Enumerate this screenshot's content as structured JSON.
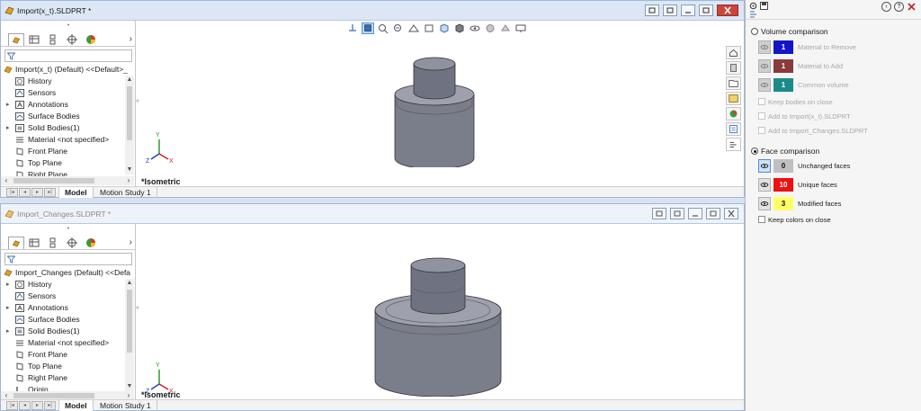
{
  "windows": [
    {
      "title": "Import(x_t).SLDPRT *",
      "root": "Import(x_t) (Default) <<Default>_",
      "tree": [
        {
          "label": "History",
          "arrow": ""
        },
        {
          "label": "Sensors",
          "arrow": ""
        },
        {
          "label": "Annotations",
          "arrow": "▸"
        },
        {
          "label": "Surface Bodies",
          "arrow": ""
        },
        {
          "label": "Solid Bodies(1)",
          "arrow": "▸"
        },
        {
          "label": "Material <not specified>",
          "arrow": ""
        },
        {
          "label": "Front Plane",
          "arrow": ""
        },
        {
          "label": "Top Plane",
          "arrow": ""
        },
        {
          "label": "Right Plane",
          "arrow": ""
        }
      ],
      "view_label": "*Isometric"
    },
    {
      "title": "Import_Changes.SLDPRT *",
      "root": "Import_Changes (Default) <<Defa",
      "tree": [
        {
          "label": "History",
          "arrow": "▸"
        },
        {
          "label": "Sensors",
          "arrow": ""
        },
        {
          "label": "Annotations",
          "arrow": "▸"
        },
        {
          "label": "Surface Bodies",
          "arrow": ""
        },
        {
          "label": "Solid Bodies(1)",
          "arrow": "▸"
        },
        {
          "label": "Material <not specified>",
          "arrow": ""
        },
        {
          "label": "Front Plane",
          "arrow": ""
        },
        {
          "label": "Top Plane",
          "arrow": ""
        },
        {
          "label": "Right Plane",
          "arrow": ""
        },
        {
          "label": "Origin",
          "arrow": ""
        }
      ],
      "view_label": "*Isometric"
    }
  ],
  "tabs": {
    "model": "Model",
    "motion": "Motion Study 1"
  },
  "triad": {
    "x": "X",
    "y": "Y",
    "z": "Z"
  },
  "property_manager": {
    "volume_comparison": {
      "label": "Volume comparison",
      "selected": false,
      "rows": [
        {
          "count": "1",
          "label": "Material to Remove",
          "color": "#1414c8"
        },
        {
          "count": "1",
          "label": "Material to Add",
          "color": "#8a3a3a"
        },
        {
          "count": "1",
          "label": "Common volume",
          "color": "#1a8a8a"
        }
      ],
      "checks": [
        {
          "label": "Keep bodies on close",
          "enabled": false
        },
        {
          "label": "Add to Import(x_t).SLDPRT",
          "enabled": false
        },
        {
          "label": "Add to Import_Changes.SLDPRT",
          "enabled": false
        }
      ]
    },
    "face_comparison": {
      "label": "Face comparison",
      "selected": true,
      "rows": [
        {
          "count": "0",
          "label": "Unchanged faces",
          "color": "#c0c0c0",
          "text": "#111111"
        },
        {
          "count": "10",
          "label": "Unique faces",
          "color": "#ee1111",
          "text": "#ffffff"
        },
        {
          "count": "3",
          "label": "Modified faces",
          "color": "#ffff66",
          "text": "#111111"
        }
      ],
      "checks": [
        {
          "label": "Keep colors on close",
          "enabled": true
        }
      ]
    }
  },
  "colors": {
    "accent": "#5f97d1",
    "close": "#c9463d",
    "part": "#7a7d8a"
  }
}
